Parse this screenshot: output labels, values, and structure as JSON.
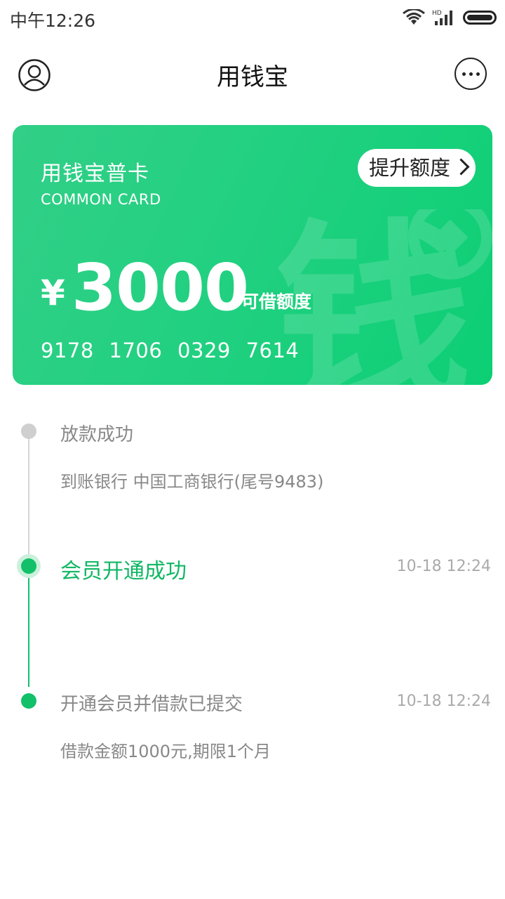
{
  "status_bar": {
    "time": "中午12:26",
    "network": "HD"
  },
  "header": {
    "title": "用钱宝"
  },
  "card": {
    "name": "用钱宝普卡",
    "subtitle": "COMMON CARD",
    "upgrade_label": "提升额度",
    "currency": "¥",
    "amount": "3000",
    "amount_label": "可借额度",
    "card_number": "9178 1706 0329 7614",
    "watermark_char": "钱"
  },
  "timeline": [
    {
      "title": "放款成功",
      "desc": "到账银行 中国工商银行(尾号9483)",
      "time": ""
    },
    {
      "title": "会员开通成功",
      "desc": "",
      "time": "10-18 12:24"
    },
    {
      "title": "开通会员并借款已提交",
      "desc": "借款金额1000元,期限1个月",
      "time": "10-18 12:24"
    }
  ],
  "colors": {
    "accent": "#12c06a",
    "card_start": "#32cf87",
    "card_end": "#0ccf74"
  }
}
